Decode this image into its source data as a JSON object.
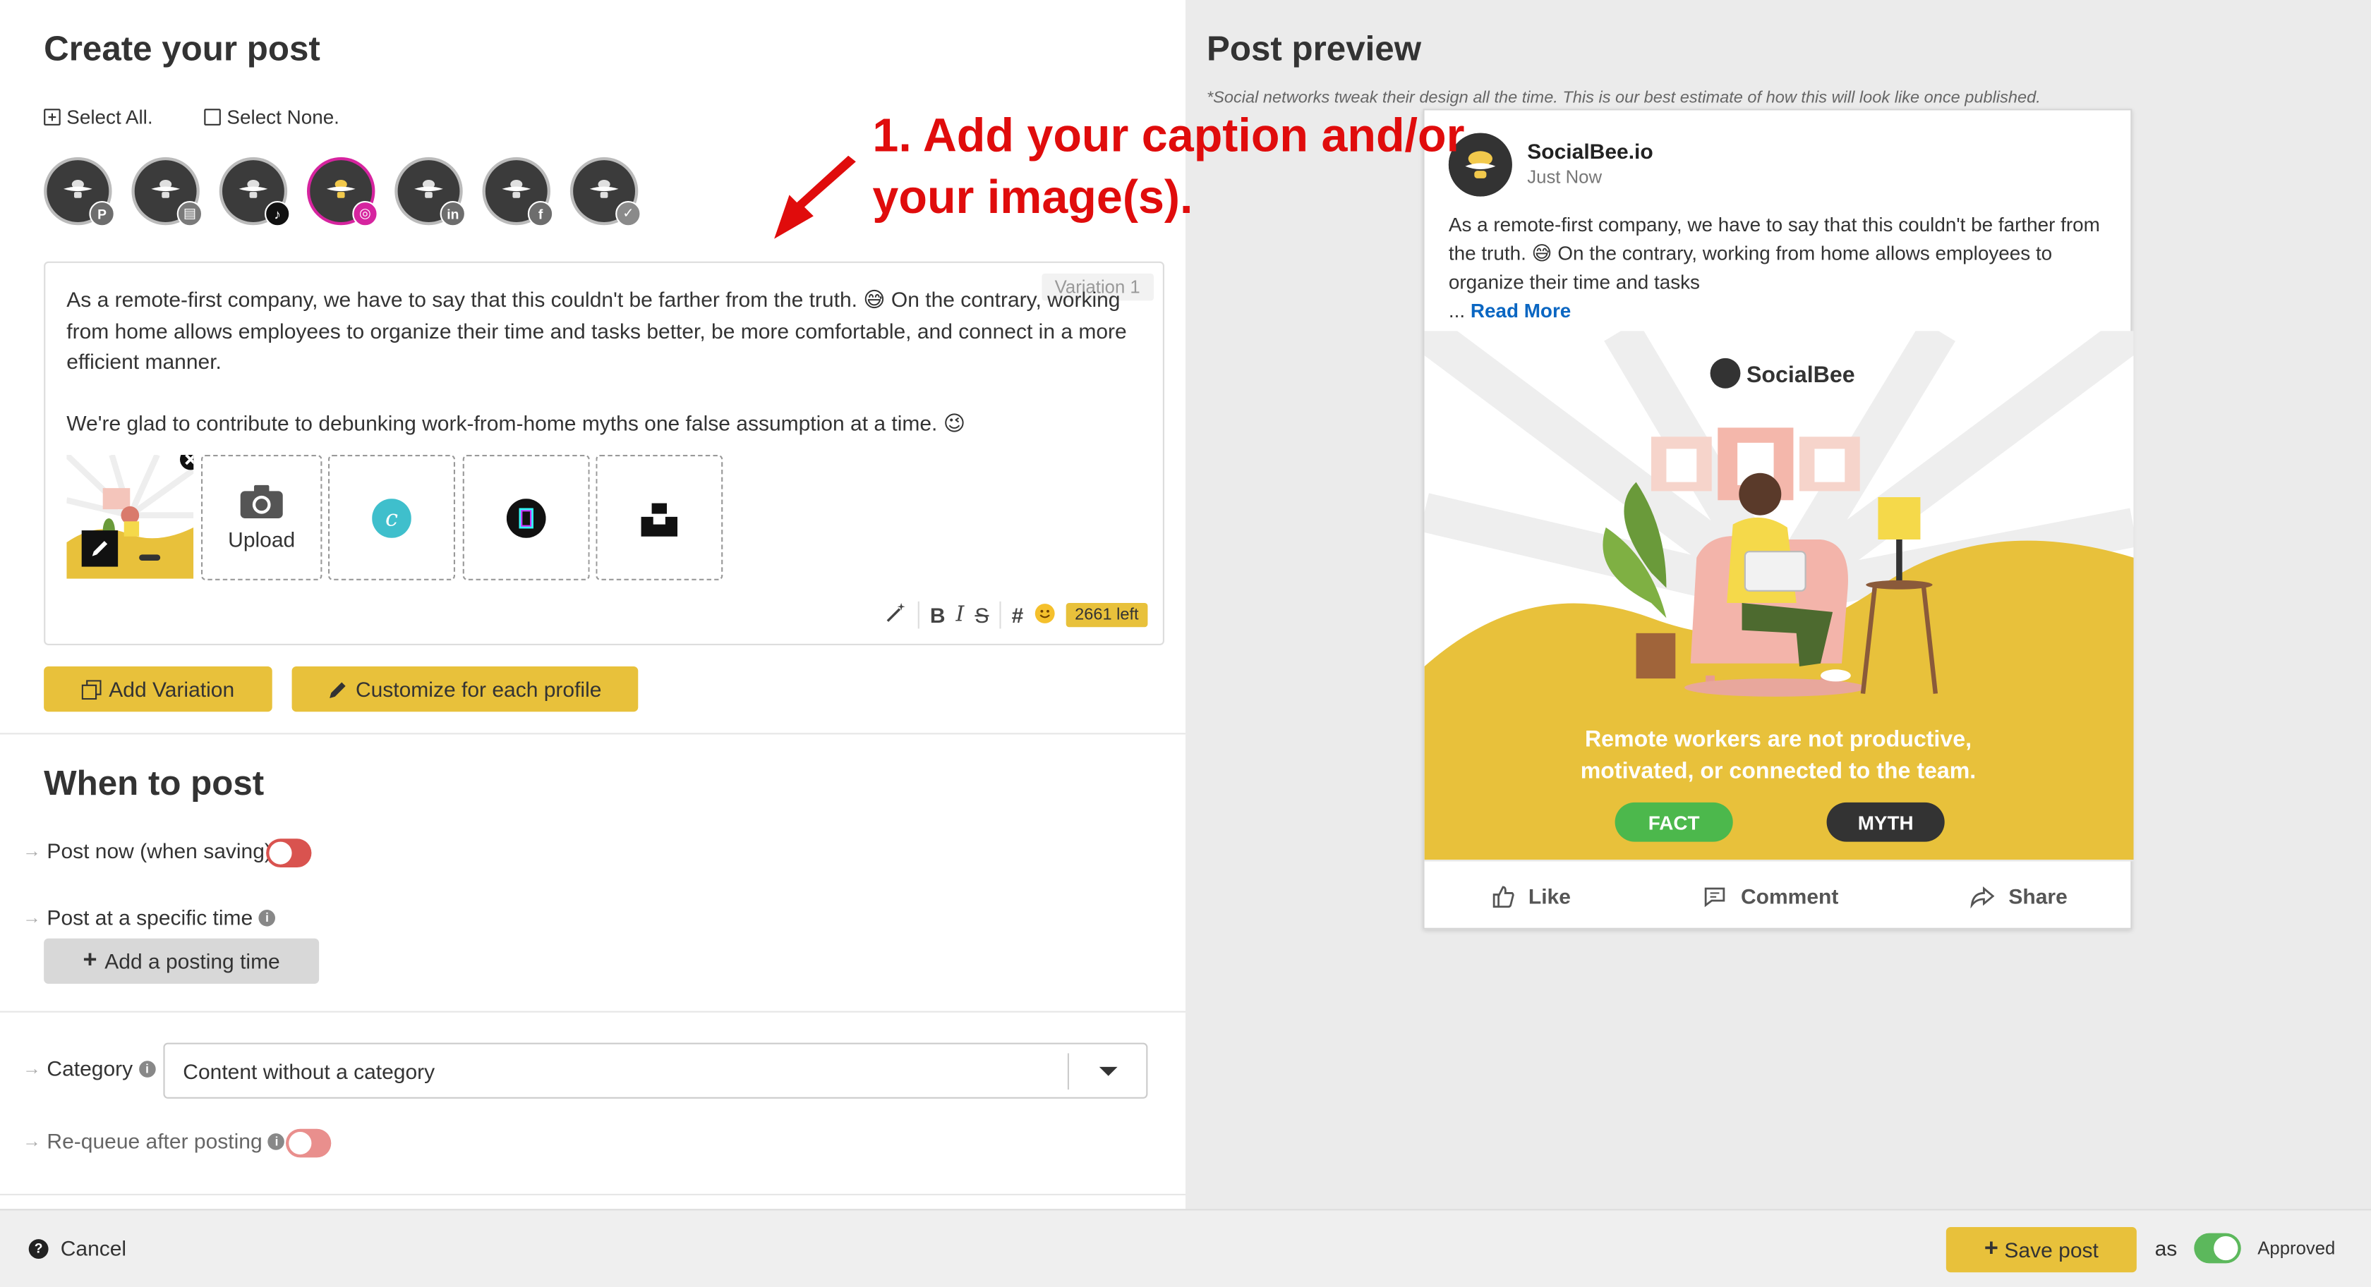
{
  "create": {
    "title": "Create your post",
    "select_all": "Select All.",
    "select_none": "Select None.",
    "profiles": [
      {
        "network": "pinterest",
        "badge": "P",
        "color": "#6d6d6d",
        "active": false
      },
      {
        "network": "google-business",
        "badge": "▤",
        "color": "#7a7a7a",
        "active": false
      },
      {
        "network": "tiktok",
        "badge": "♪",
        "color": "#111111",
        "active": false
      },
      {
        "network": "instagram",
        "badge": "◎",
        "color": "#d6249f",
        "active": true
      },
      {
        "network": "linkedin",
        "badge": "in",
        "color": "#6d6d6d",
        "active": false
      },
      {
        "network": "facebook",
        "badge": "f",
        "color": "#6d6d6d",
        "active": false
      },
      {
        "network": "twitter",
        "badge": "✓",
        "color": "#8a8a8a",
        "active": false
      }
    ],
    "variation_label": "Variation 1",
    "caption_p1": "As a remote-first company, we have to say that this couldn't be farther from the truth. 😅 On the contrary, working from home allows employees to organize their time and tasks better, be more comfortable, and connect in a more efficient manner.",
    "caption_p2": "We're glad to contribute to debunking work-from-home myths one false assumption at a time. 😉",
    "upload_label": "Upload",
    "chars_left": "2661 left",
    "add_variation": "Add Variation",
    "customize": "Customize for each profile"
  },
  "annotation": {
    "line1": "1. Add your caption and/or",
    "line2": "your image(s)."
  },
  "when": {
    "title": "When to post",
    "post_now": "Post now (when saving)",
    "post_specific": "Post at a specific time",
    "add_time": "Add a posting time",
    "category_label": "Category",
    "category_value": "Content without a category",
    "requeue": "Re-queue after posting"
  },
  "preview": {
    "title": "Post preview",
    "note": "*Social networks tweak their design all the time. This is our best estimate of how this will look like once published.",
    "name": "SocialBee.io",
    "time": "Just Now",
    "text": "As a remote-first company, we have to say that this couldn't be farther from the truth. 😅 On the contrary, working from home allows employees to organize their time and tasks",
    "ellipsis": "...",
    "read_more": "Read More",
    "image_brand": "SocialBee",
    "image_claim_1": "Remote workers are not productive,",
    "image_claim_2": "motivated, or connected to the team.",
    "fact": "FACT",
    "myth": "MYTH",
    "like": "Like",
    "comment": "Comment",
    "share": "Share"
  },
  "footer": {
    "cancel": "Cancel",
    "save": "Save post",
    "as": "as",
    "status": "Approved"
  },
  "colors": {
    "accent": "#e8c13b",
    "toggle_off": "#d9534f",
    "toggle_on": "#5cb85c",
    "link": "#0a66c2",
    "annotation": "#e00c0c"
  }
}
